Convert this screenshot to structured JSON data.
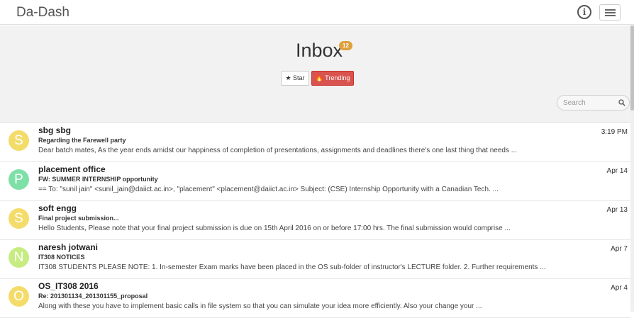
{
  "app": {
    "title": "Da-Dash"
  },
  "header": {
    "title": "Inbox",
    "unread_count": "12",
    "star_label": "★ Star",
    "trending_label": "🔥 Trending"
  },
  "search": {
    "placeholder": "Search",
    "value": ""
  },
  "colors": {
    "trending": "#d9534f",
    "badge": "#e0a13b",
    "avatar_yellow": "#f4dc6a",
    "avatar_green": "#7ee0a6",
    "avatar_lime": "#c6ec82"
  },
  "messages": [
    {
      "initial": "S",
      "sender": "sbg sbg",
      "subject": "Regarding the Farewell party",
      "preview": "Dear batch mates, As the year ends amidst our happiness of completion of presentations, assignments and deadlines there's one last thing that needs ...",
      "date": "3:19 PM",
      "avatar_color": "#f4dc6a"
    },
    {
      "initial": "P",
      "sender": "placement office",
      "subject": "FW: SUMMER INTERNSHIP opportunity",
      "preview": "== To: \"sunil jain\" <sunil_jain@daiict.ac.in>, \"placement\" <placement@daiict.ac.in> Subject: (CSE) Internship Opportunity with a Canadian Tech. ...",
      "date": "Apr 14",
      "avatar_color": "#7ee0a6"
    },
    {
      "initial": "S",
      "sender": "soft engg",
      "subject": "Final project submission...",
      "preview": "Hello Students, Please note that your final project submission is due on 15th April 2016 on or before 17:00 hrs. The final submission would comprise ...",
      "date": "Apr 13",
      "avatar_color": "#f4dc6a"
    },
    {
      "initial": "N",
      "sender": "naresh jotwani",
      "subject": "IT308 NOTICES",
      "preview": "IT308 STUDENTS PLEASE NOTE: 1. In-semester Exam marks have been placed in the OS sub-folder of instructor's LECTURE folder. 2. Further requirements ...",
      "date": "Apr 7",
      "avatar_color": "#c6ec82"
    },
    {
      "initial": "O",
      "sender": "OS_IT308 2016",
      "subject": "Re: 201301134_201301155_proposal",
      "preview": "Along with these you have to implement basic calls in file system so that you can simulate your idea more efficiently. Also your change your ...",
      "date": "Apr 4",
      "avatar_color": "#f4dc6a"
    }
  ]
}
